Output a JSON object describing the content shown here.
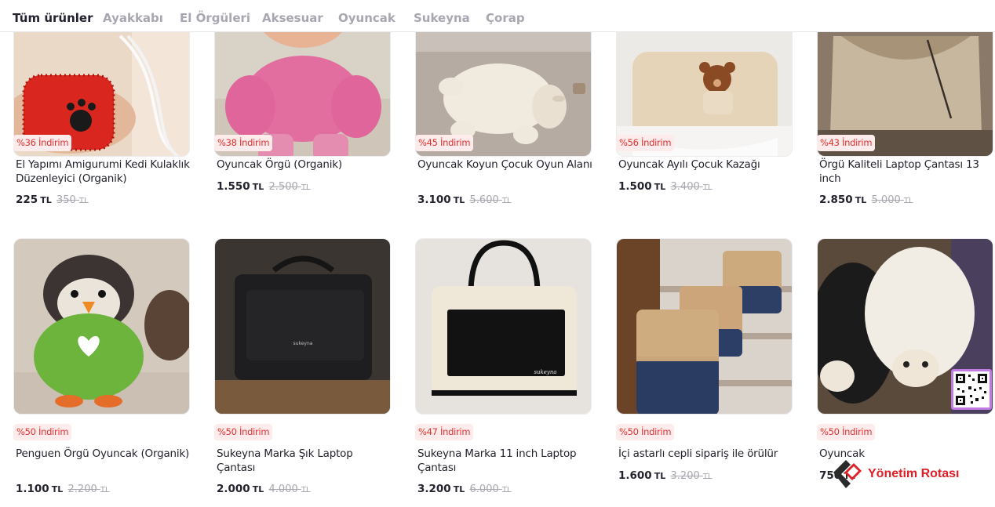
{
  "tabs": [
    "Tüm ürünler",
    "Ayakkabı",
    "El Örgüleri",
    "Aksesuar",
    "Oyuncak",
    "Sukeyna",
    "Çorap"
  ],
  "active_tab": "Tüm ürünler",
  "products": [
    {
      "badge": "%36 İndirim",
      "name": "El Yapımı Amigurumi Kedi Kulaklık Düzenleyici (Organik)",
      "price": "225",
      "currency": "TL",
      "old_price": "350",
      "old_currency": "TL",
      "image": "red amigurumi earphone organizer"
    },
    {
      "badge": "%38 İndirim",
      "name": "Oyuncak Örgü (Organik)",
      "price": "1.550",
      "currency": "TL",
      "old_price": "2.500",
      "old_currency": "TL",
      "image": "pink knitted toy"
    },
    {
      "badge": "%45 İndirim",
      "name": "Oyuncak Koyun Çocuk Oyun Alanı",
      "price": "3.100",
      "currency": "TL",
      "old_price": "5.600",
      "old_currency": "TL",
      "image": "sheep play mat"
    },
    {
      "badge": "%56 İndirim",
      "name": "Oyuncak Ayılı Çocuk Kazağı",
      "price": "1.500",
      "currency": "TL",
      "old_price": "3.400",
      "old_currency": "TL",
      "image": "sweater with teddy bear"
    },
    {
      "badge": "%43 İndirim",
      "name": "Örgü Kaliteli Laptop Çantası 13 inch",
      "price": "2.850",
      "currency": "TL",
      "old_price": "5.000",
      "old_currency": "TL",
      "image": "knitted laptop bag"
    },
    {
      "badge": "%50 İndirim",
      "name": "Penguen Örgü Oyuncak (Organik)",
      "price": "1.100",
      "currency": "TL",
      "old_price": "2.200",
      "old_currency": "TL",
      "image": "knitted penguin toy"
    },
    {
      "badge": "%50 İndirim",
      "name": "Sukeyna Marka Şık Laptop Çantası",
      "price": "2.000",
      "currency": "TL",
      "old_price": "4.000",
      "old_currency": "TL",
      "image": "black laptop bag",
      "brand_text": "sukeyna"
    },
    {
      "badge": "%47 İndirim",
      "name": "Sukeyna Marka 11 inch Laptop Çantası",
      "price": "3.200",
      "currency": "TL",
      "old_price": "6.000",
      "old_currency": "TL",
      "image": "cream and black laptop bag",
      "brand_text": "sukeyna"
    },
    {
      "badge": "%50 İndirim",
      "name": "İçi astarlı cepli sipariş ile örülür",
      "price": "1.600",
      "currency": "TL",
      "old_price": "3.200",
      "old_currency": "TL",
      "image": "knitted tote bags on stairs"
    },
    {
      "badge": "%50 İndirim",
      "name": "Oyuncak",
      "price": "750",
      "currency": "TL",
      "old_price": "",
      "old_currency": "",
      "image": "sheep rug"
    }
  ],
  "watermark": {
    "text": "Yönetim Rotası"
  },
  "colors": {
    "discount": "#e0312f",
    "discount_bg": "#fdeceb",
    "active_tab": "#222231",
    "inactive_tab": "#a7a7b2"
  }
}
